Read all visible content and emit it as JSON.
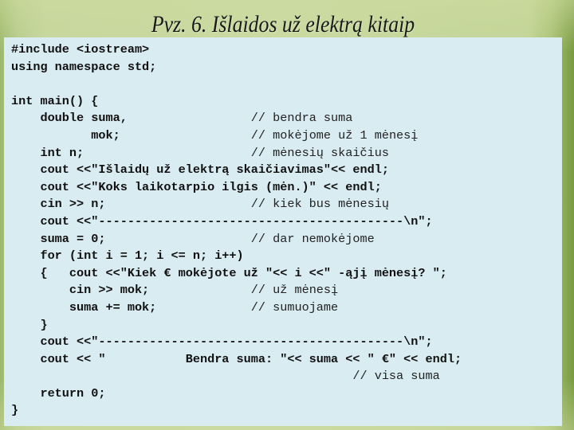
{
  "slide": {
    "title": "Pvz. 6. Išlaidos už elektrą kitaip"
  },
  "code": {
    "language": "C++",
    "lines": [
      {
        "code": "#include <iostream>",
        "comment": ""
      },
      {
        "code": "using namespace std;",
        "comment": ""
      },
      {
        "code": "",
        "comment": ""
      },
      {
        "code": "int main() {",
        "comment": ""
      },
      {
        "code": "    double suma,",
        "comment": "// bendra suma"
      },
      {
        "code": "           mok;",
        "comment": "// mokėjome už 1 mėnesį"
      },
      {
        "code": "    int n;",
        "comment": "// mėnesių skaičius"
      },
      {
        "code": "    cout <<\"Išlaidų už elektrą skaičiavimas\"<< endl;",
        "comment": ""
      },
      {
        "code": "    cout <<\"Koks laikotarpio ilgis (mėn.)\" << endl;",
        "comment": ""
      },
      {
        "code": "    cin >> n;",
        "comment": "// kiek bus mėnesių"
      },
      {
        "code": "    cout <<\"------------------------------------------\\n\";",
        "comment": ""
      },
      {
        "code": "    suma = 0;",
        "comment": "// dar nemokėjome"
      },
      {
        "code": "    for (int i = 1; i <= n; i++)",
        "comment": ""
      },
      {
        "code": "    {   cout <<\"Kiek € mokėjote už \"<< i <<\" -ąjį mėnesį? \";",
        "comment": ""
      },
      {
        "code": "        cin >> mok;",
        "comment": "// už mėnesį"
      },
      {
        "code": "        suma += mok;",
        "comment": "// sumuojame"
      },
      {
        "code": "    }",
        "comment": ""
      },
      {
        "code": "    cout <<\"------------------------------------------\\n\";",
        "comment": ""
      },
      {
        "code": "    cout << \"           Bendra suma: \"<< suma << \" €\" << endl;",
        "comment": ""
      },
      {
        "code": "",
        "comment": "// visa suma",
        "comment_col": 47
      },
      {
        "code": "    return 0;",
        "comment": ""
      },
      {
        "code": "}",
        "comment": ""
      }
    ]
  }
}
